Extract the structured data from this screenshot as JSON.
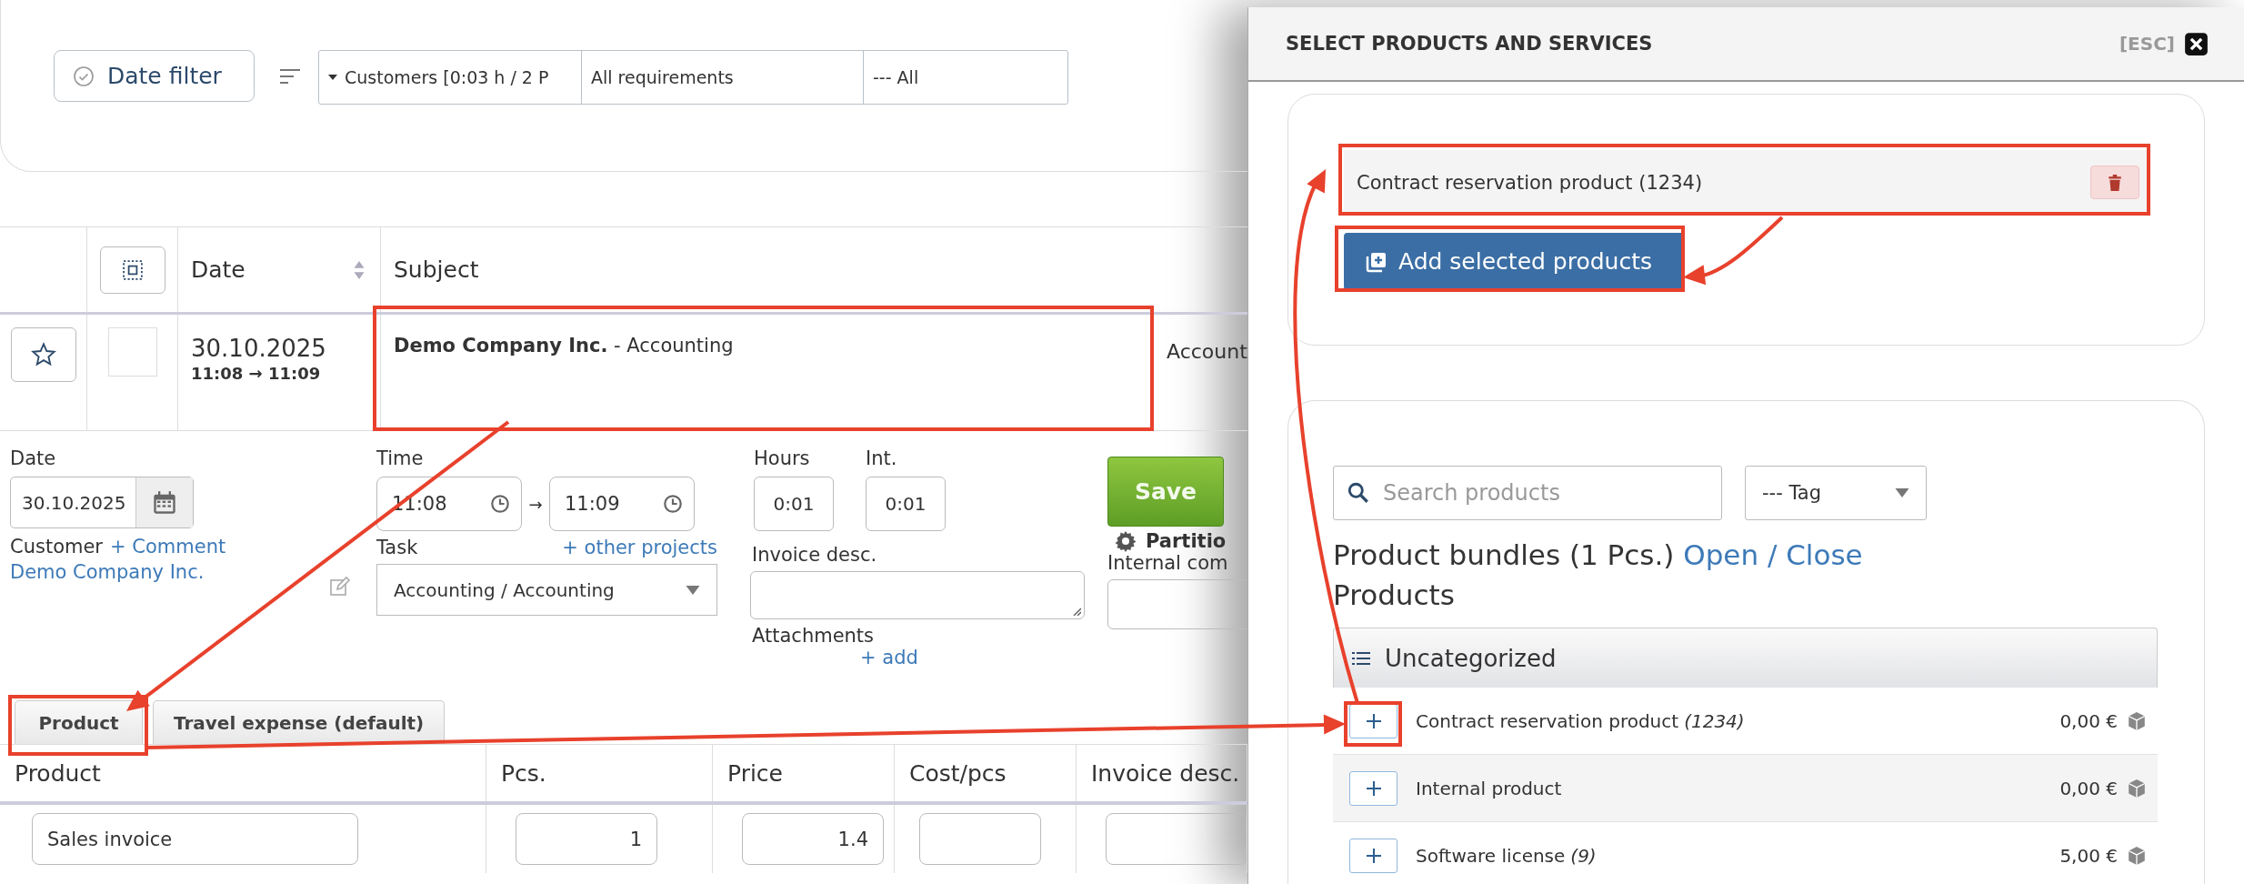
{
  "filter_bar": {
    "date_filter": "Date filter",
    "selects": [
      "Customers [0:03 h / 2 P",
      "All requirements",
      "--- All"
    ]
  },
  "entries_table": {
    "columns": [
      {
        "label": "Date",
        "sortable": true
      },
      {
        "label": "Subject",
        "sortable": false
      }
    ],
    "rows": [
      {
        "starred": false,
        "selected": false,
        "date": "30.10.2025",
        "time": "11:08 → 11:09",
        "subject": "**Demo Company Inc.**  - Accounting",
        "column_4": "Account"
      }
    ]
  },
  "form": {
    "date_label": "Date",
    "date": "30.10.2025",
    "customer_label": "Customer",
    "comment_link": "+ Comment",
    "customer": "Demo Company Inc.",
    "time_label": "Time",
    "time_start": "11:08",
    "time_arrow": "→",
    "time_end": "11:09",
    "task_label": "Task",
    "other_projects_link": "+ other projects",
    "task": "Accounting / Accounting",
    "hours_label": "Hours",
    "hours": "0:01",
    "int_label": "Int.",
    "int": "0:01",
    "invoice_desc_label": "Invoice desc.",
    "attachments_label": "Attachments",
    "add_link": "+ add",
    "save": "Save",
    "partition": "Partitio",
    "internal_comment_label": "Internal com"
  },
  "tabs": [
    {
      "label": "Product"
    },
    {
      "label": "Travel expense (default)"
    }
  ],
  "product_table": {
    "columns": [
      "Product",
      "Pcs.",
      "Price",
      "Cost/pcs",
      "Invoice desc."
    ],
    "rows": [
      {
        "product": "Sales invoice",
        "pcs": "1",
        "price": "1.4"
      }
    ]
  },
  "modal": {
    "title": "SELECT PRODUCTS AND SERVICES",
    "esc": "[ESC]",
    "selected_items": [
      {
        "label": "Contract reservation product (1234)"
      }
    ],
    "add_button": "Add selected products",
    "search_placeholder": "Search products",
    "tag_select": "--- Tag",
    "bundles_text": "Product bundles (1 Pcs.)",
    "bundles_link": "Open / Close",
    "products_heading": "Products",
    "category": "Uncategorized",
    "products": [
      {
        "name": "Contract reservation product",
        "code": "(1234)",
        "price": "0,00 €"
      },
      {
        "name": "Internal product",
        "price": "0,00 €"
      },
      {
        "name": "Software license",
        "code": "(9)",
        "price": "5,00 €"
      }
    ]
  }
}
